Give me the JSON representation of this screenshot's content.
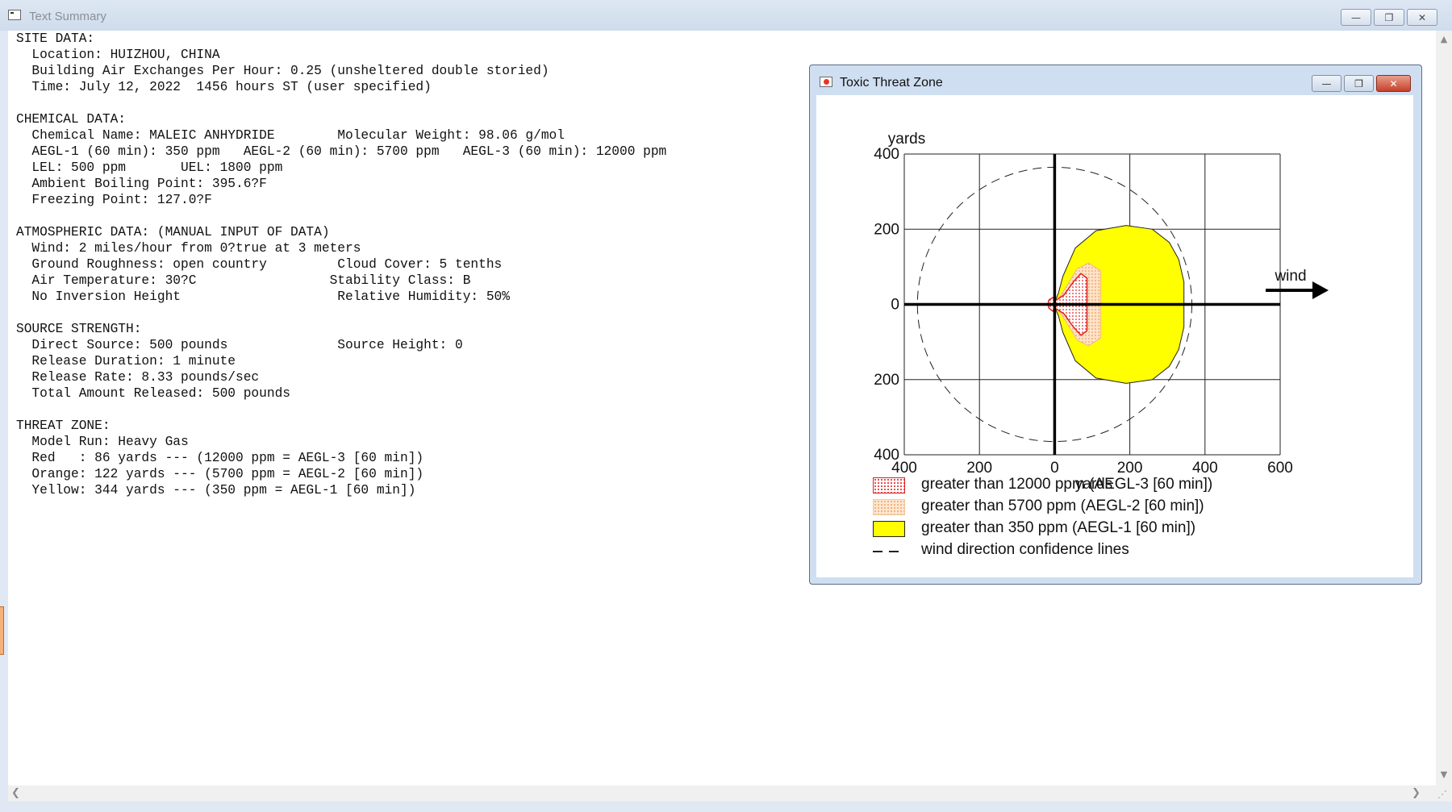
{
  "window": {
    "title": "Text Summary",
    "buttons": {
      "minimize": "—",
      "maximize": "❐",
      "close": "✕"
    }
  },
  "summary": {
    "lines": [
      "SITE DATA:",
      "  Location: HUIZHOU, CHINA",
      "  Building Air Exchanges Per Hour: 0.25 (unsheltered double storied)",
      "  Time: July 12, 2022  1456 hours ST (user specified)",
      "",
      "CHEMICAL DATA:",
      "  Chemical Name: MALEIC ANHYDRIDE        Molecular Weight: 98.06 g/mol",
      "  AEGL-1 (60 min): 350 ppm   AEGL-2 (60 min): 5700 ppm   AEGL-3 (60 min): 12000 ppm",
      "  LEL: 500 ppm       UEL: 1800 ppm",
      "  Ambient Boiling Point: 395.6?F",
      "  Freezing Point: 127.0?F",
      "",
      "ATMOSPHERIC DATA: (MANUAL INPUT OF DATA)",
      "  Wind: 2 miles/hour from 0?true at 3 meters",
      "  Ground Roughness: open country         Cloud Cover: 5 tenths",
      "  Air Temperature: 30?C                 Stability Class: B",
      "  No Inversion Height                    Relative Humidity: 50%",
      "",
      "SOURCE STRENGTH:",
      "  Direct Source: 500 pounds              Source Height: 0",
      "  Release Duration: 1 minute",
      "  Release Rate: 8.33 pounds/sec",
      "  Total Amount Released: 500 pounds",
      "",
      "THREAT ZONE:",
      "  Model Run: Heavy Gas",
      "  Red   : 86 yards --- (12000 ppm = AEGL-3 [60 min])",
      "  Orange: 122 yards --- (5700 ppm = AEGL-2 [60 min])",
      "  Yellow: 344 yards --- (350 ppm = AEGL-1 [60 min])"
    ]
  },
  "threat_window": {
    "title": "Toxic Threat Zone",
    "buttons": {
      "minimize": "—",
      "maximize": "❐",
      "close": "✕"
    }
  },
  "plot": {
    "x_axis_label": "yards",
    "y_axis_label": "yards",
    "x_ticks": [
      "400",
      "200",
      "0",
      "200",
      "400",
      "600"
    ],
    "y_ticks": [
      "400",
      "200",
      "0",
      "200",
      "400"
    ],
    "wind_label": "wind",
    "colors": {
      "red": "#e02020",
      "orange": "#f5b07a",
      "yellow": "#ffff00"
    }
  },
  "chart_data": {
    "type": "area",
    "x_range": [
      -400,
      600
    ],
    "y_range": [
      -400,
      400
    ],
    "grid": true,
    "zones": [
      {
        "name": "Red",
        "max_distance_yards": 86,
        "threshold_ppm": 12000
      },
      {
        "name": "Orange",
        "max_distance_yards": 122,
        "threshold_ppm": 5700
      },
      {
        "name": "Yellow",
        "max_distance_yards": 344,
        "threshold_ppm": 350,
        "max_half_width_yards": 210
      }
    ],
    "confidence_circle_radius_yards": 365
  },
  "legend": {
    "items": [
      {
        "label": "greater than 12000 ppm (AEGL-3 [60 min])"
      },
      {
        "label": "greater than 5700 ppm (AEGL-2 [60 min])"
      },
      {
        "label": "greater than 350 ppm (AEGL-1 [60 min])"
      },
      {
        "label": "wind direction confidence lines"
      }
    ]
  },
  "scrollbars": {
    "up": "▲",
    "down": "▼",
    "left": "❮",
    "right": "❯",
    "grip": "⋰"
  }
}
